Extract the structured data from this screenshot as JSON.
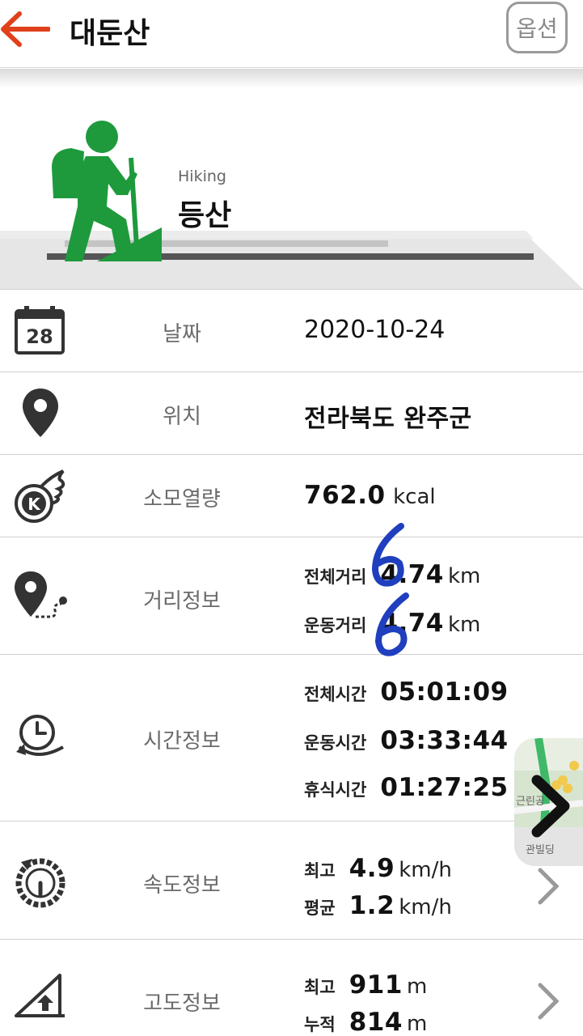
{
  "header": {
    "title": "대둔산",
    "option_label": "옵션"
  },
  "banner": {
    "activity_sub": "Hiking",
    "activity_name": "등산"
  },
  "rows": {
    "date": {
      "label": "날짜",
      "value": "2020-10-24",
      "calendar_day": "28"
    },
    "location": {
      "label": "위치",
      "value": "전라북도 완주군"
    },
    "calories": {
      "label": "소모열량",
      "value": "762.0",
      "unit": "kcal"
    },
    "distance": {
      "label": "거리정보",
      "total_label": "전체거리",
      "total_value": "4.74",
      "total_unit": "km",
      "moving_label": "운동거리",
      "moving_value": "4.74",
      "moving_unit": "km",
      "handwriting": "6"
    },
    "time": {
      "label": "시간정보",
      "total_label": "전체시간",
      "total_value": "05:01:09",
      "moving_label": "운동시간",
      "moving_value": "03:33:44",
      "rest_label": "휴식시간",
      "rest_value": "01:27:25"
    },
    "speed": {
      "label": "속도정보",
      "max_label": "최고",
      "max_value": "4.9",
      "max_unit": "km/h",
      "avg_label": "평균",
      "avg_value": "1.2",
      "avg_unit": "km/h"
    },
    "altitude": {
      "label": "고도정보",
      "max_label": "최고",
      "max_value": "911",
      "max_unit": "m",
      "cum_label": "누적",
      "cum_value": "814",
      "cum_unit": "m"
    }
  },
  "map_thumb": {
    "text1": "근린공",
    "text2": "관빌딩"
  },
  "colors": {
    "accent": "#e0401a",
    "hiker_green": "#1e9a3c",
    "handwriting_blue": "#1f3fbf"
  },
  "icons": [
    "back-arrow-icon",
    "calendar-icon",
    "location-pin-icon",
    "calorie-fire-icon",
    "route-pin-icon",
    "clock-icon",
    "speedometer-icon",
    "altitude-icon",
    "chevron-right-icon"
  ]
}
